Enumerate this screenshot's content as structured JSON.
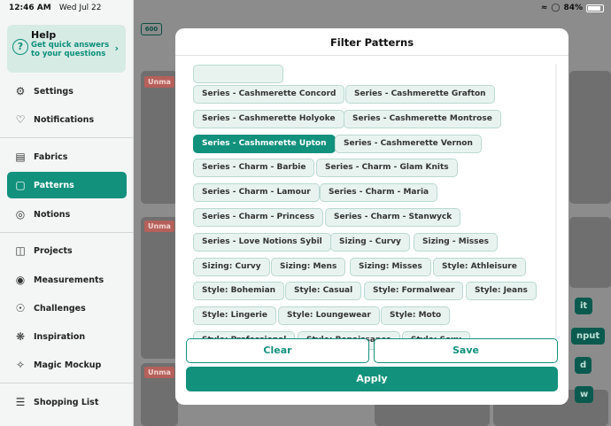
{
  "status": {
    "time": "12:46 AM",
    "date": "Wed Jul 22",
    "battery": "84%"
  },
  "help": {
    "title": "Help",
    "subtitle": "Get quick answers to your questions"
  },
  "nav": [
    {
      "label": "Settings",
      "icon": "gear-icon"
    },
    {
      "label": "Notifications",
      "icon": "bell-icon"
    },
    {
      "label": "Fabrics",
      "icon": "book-icon"
    },
    {
      "label": "Patterns",
      "icon": "pattern-icon"
    },
    {
      "label": "Notions",
      "icon": "button-icon"
    },
    {
      "label": "Projects",
      "icon": "sewing-machine-icon"
    },
    {
      "label": "Measurements",
      "icon": "tape-measure-icon"
    },
    {
      "label": "Challenges",
      "icon": "target-icon"
    },
    {
      "label": "Inspiration",
      "icon": "lightbulb-icon"
    },
    {
      "label": "Magic Mockup",
      "icon": "sparkle-icon"
    },
    {
      "label": "Shopping List",
      "icon": "list-icon"
    }
  ],
  "background": {
    "logo": "600",
    "tags": [
      "Unma",
      "Unma",
      "Unma",
      "Unma"
    ],
    "buttons": [
      "it",
      "nput",
      "d",
      "w"
    ]
  },
  "modal": {
    "title": "Filter Patterns",
    "chips": [
      "Series - Cashmerette Concord",
      "Series - Cashmerette Grafton",
      "Series - Cashmerette Holyoke",
      "Series - Cashmerette Montrose",
      "Series - Cashmerette Upton",
      "Series - Cashmerette Vernon",
      "Series - Charm - Barbie",
      "Series - Charm - Glam Knits",
      "Series - Charm - Lamour",
      "Series - Charm - Maria",
      "Series - Charm - Princess",
      "Series - Charm - Stanwyck",
      "Series - Love Notions Sybil",
      "Sizing - Curvy",
      "Sizing - Misses",
      "Sizing: Curvy",
      "Sizing: Mens",
      "Sizing: Misses",
      "Style: Athleisure",
      "Style: Bohemian",
      "Style: Casual",
      "Style: Formalwear",
      "Style: Jeans",
      "Style: Lingerie",
      "Style: Loungewear",
      "Style: Moto",
      "Style: Professional",
      "Style: Renaissance",
      "Style: Sexy"
    ],
    "selected_chip": "Series - Cashmerette Upton",
    "clear_label": "Clear",
    "save_label": "Save",
    "apply_label": "Apply"
  },
  "colors": {
    "accent": "#12917d",
    "chip_bg": "#e8f3f0",
    "sidebar_bg": "#f4f6f5"
  }
}
